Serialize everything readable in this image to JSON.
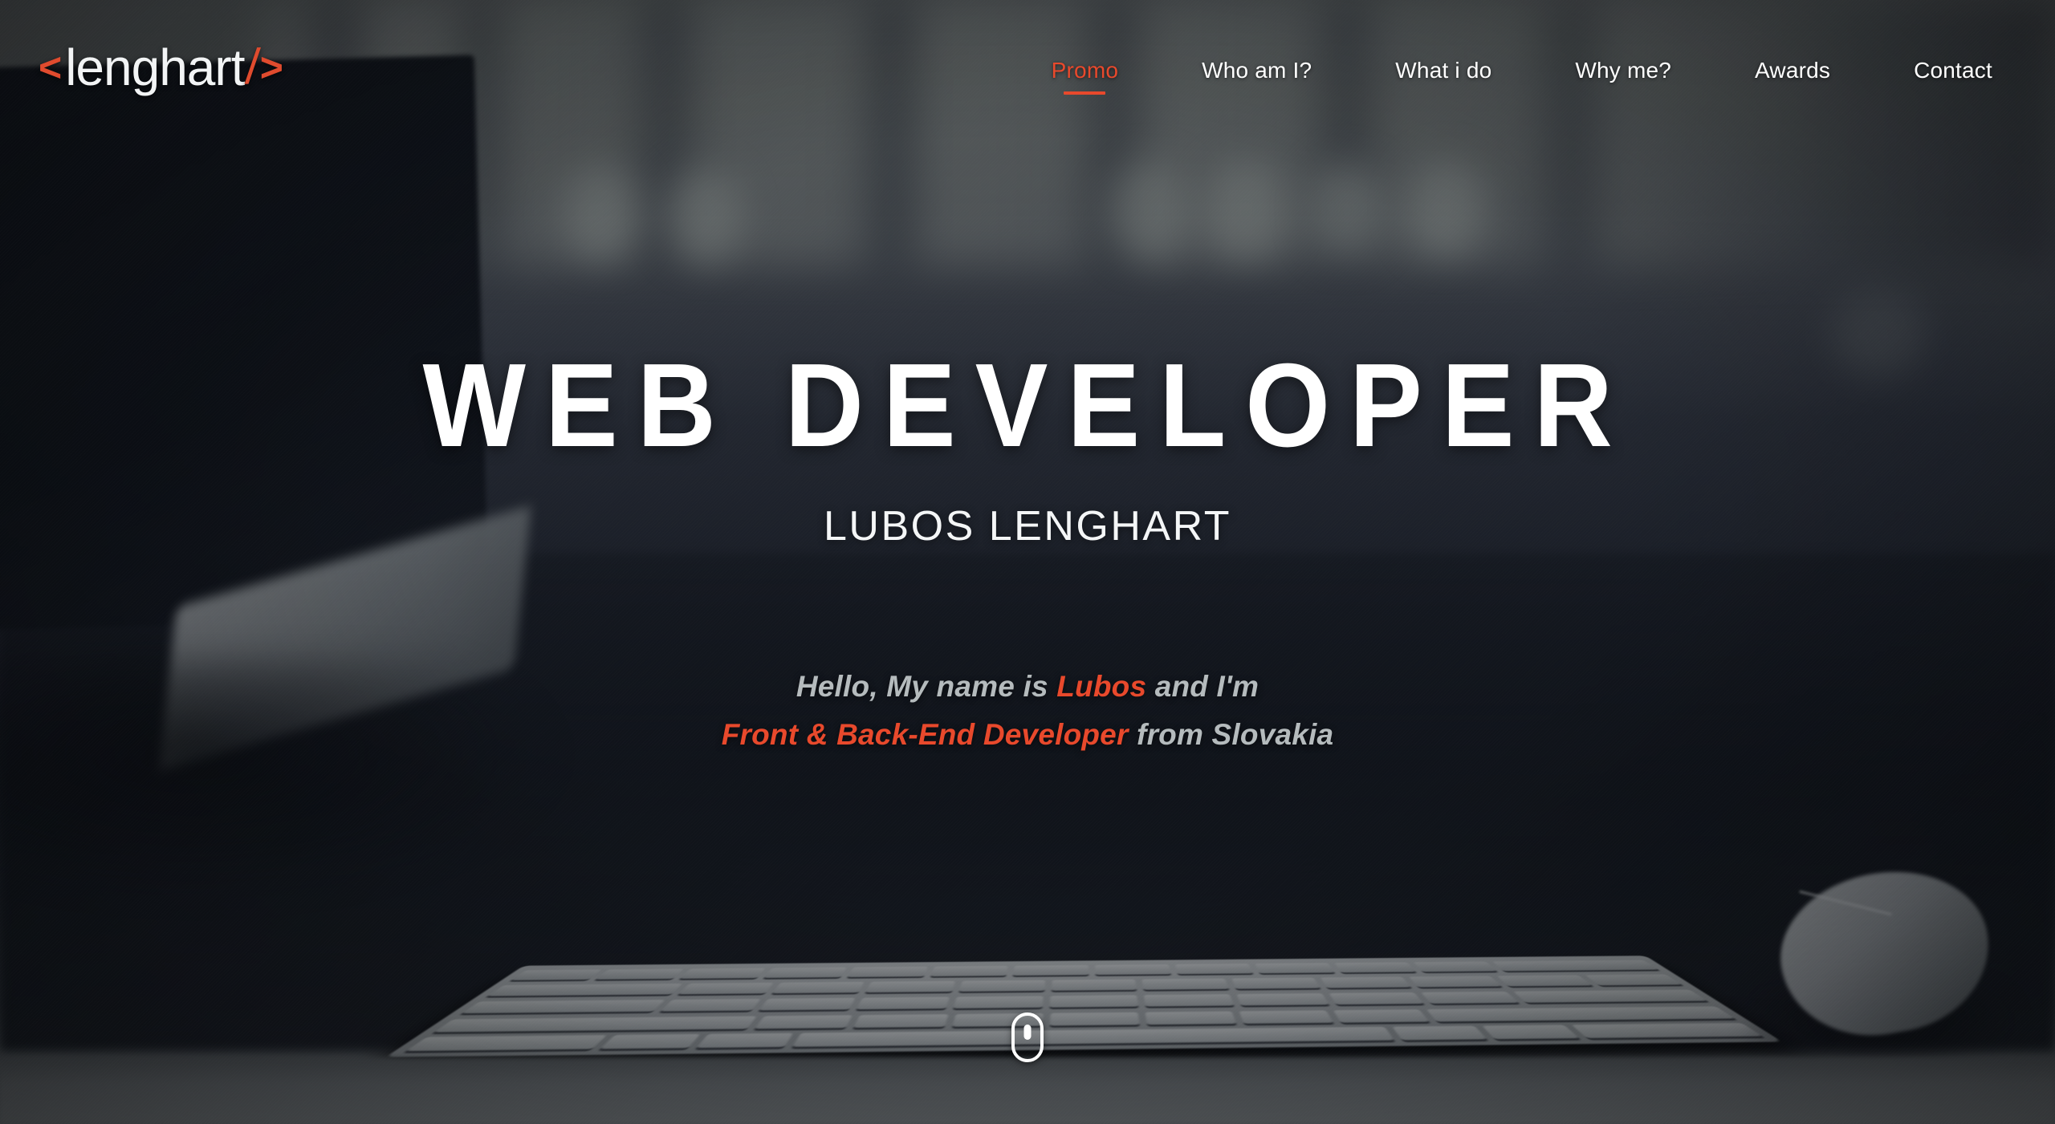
{
  "brand": {
    "bracket_left": "<",
    "name": "lenghart",
    "slash": "/",
    "bracket_right": ">",
    "accent_color": "#e8492c"
  },
  "nav": {
    "items": [
      {
        "label": "Promo",
        "active": true
      },
      {
        "label": "Who am I?",
        "active": false
      },
      {
        "label": "What i do",
        "active": false
      },
      {
        "label": "Why me?",
        "active": false
      },
      {
        "label": "Awards",
        "active": false
      },
      {
        "label": "Contact",
        "active": false
      }
    ]
  },
  "hero": {
    "title": "WEB DEVELOPER",
    "subtitle": "LUBOS LENGHART",
    "tagline": {
      "line1_part1": "Hello, My name is ",
      "line1_highlight": "Lubos",
      "line1_part2": " and I'm",
      "line2_highlight": "Front & Back-End Developer",
      "line2_part2": " from Slovakia"
    }
  },
  "scroll_indicator": {
    "name": "scroll-down-mouse"
  },
  "colors": {
    "accent": "#e8492c",
    "text_light": "#ffffff",
    "text_muted": "#b5bbbd",
    "background_dark": "#161a22"
  }
}
